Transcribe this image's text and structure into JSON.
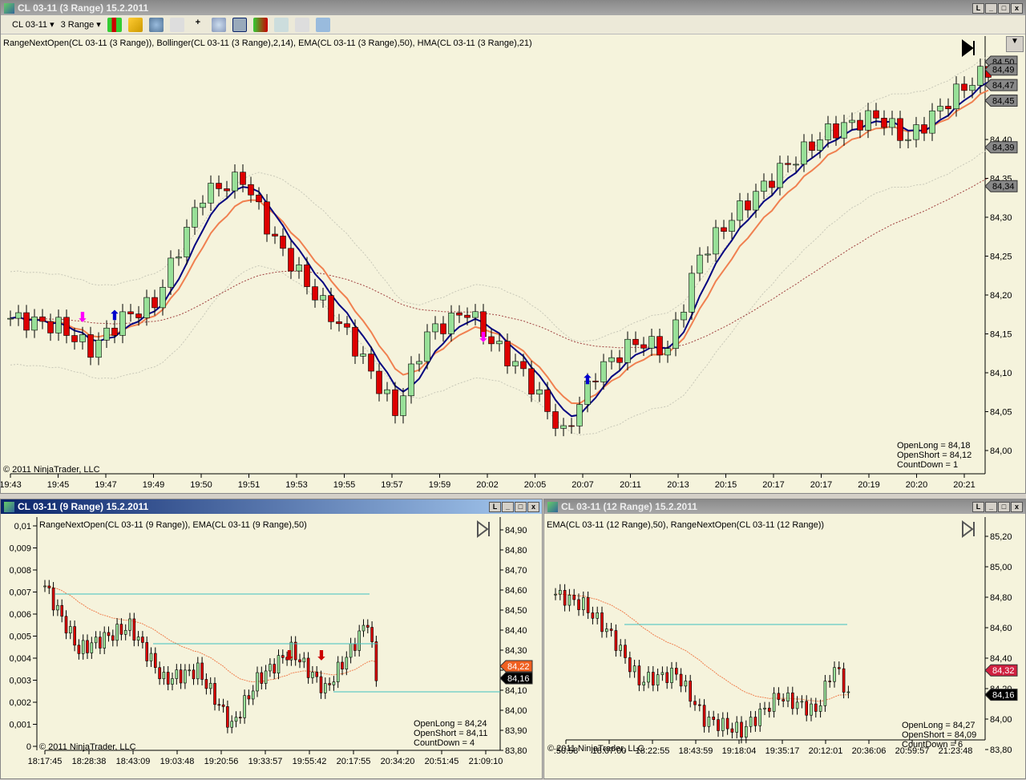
{
  "main": {
    "title": "CL 03-11 (3 Range)  15.2.2011",
    "instrument": "CL 03-11",
    "period": "3 Range",
    "indicators": "RangeNextOpen(CL 03-11 (3 Range)), Bollinger(CL 03-11 (3 Range),2,14), EMA(CL 03-11 (3 Range),50), HMA(CL 03-11 (3 Range),21)",
    "copyright": "© 2011 NinjaTrader, LLC",
    "open_long": "OpenLong = 84,18",
    "open_short": "OpenShort = 84,12",
    "countdown": "CountDown = 1",
    "price_ticks": [
      "84,00",
      "84,05",
      "84,10",
      "84,15",
      "84,20",
      "84,25",
      "84,30",
      "84,35",
      "84,40",
      "84,45",
      "84,50"
    ],
    "price_tags": [
      "84,50",
      "84,49",
      "84,47",
      "84,45",
      "84,39",
      "84,34"
    ],
    "time_ticks": [
      "19:43",
      "19:45",
      "19:47",
      "19:49",
      "19:50",
      "19:51",
      "19:53",
      "19:55",
      "19:57",
      "19:59",
      "20:02",
      "20:05",
      "20:07",
      "20:11",
      "20:13",
      "20:15",
      "20:17",
      "20:17",
      "20:19",
      "20:20",
      "20:21"
    ]
  },
  "left": {
    "title": "CL 03-11 (9 Range)  15.2.2011",
    "indicators": "RangeNextOpen(CL 03-11 (9 Range)), EMA(CL 03-11 (9 Range),50)",
    "copyright": "© 2011 NinjaTrader, LLC",
    "open_long": "OpenLong = 84,24",
    "open_short": "OpenShort = 84,11",
    "countdown": "CountDown = 4",
    "left_ticks": [
      "0",
      "0,001",
      "0,002",
      "0,003",
      "0,004",
      "0,005",
      "0,006",
      "0,007",
      "0,008",
      "0,009",
      "0,01"
    ],
    "price_ticks": [
      "83,80",
      "83,90",
      "84,00",
      "84,10",
      "84,20",
      "84,30",
      "84,40",
      "84,50",
      "84,60",
      "84,70",
      "84,80",
      "84,90"
    ],
    "tag_ema": "84,22",
    "tag_last": "84,16",
    "time_ticks": [
      "18:17:45",
      "18:28:38",
      "18:43:09",
      "19:03:48",
      "19:20:56",
      "19:33:57",
      "19:55:42",
      "20:17:55",
      "20:34:20",
      "20:51:45",
      "21:09:10"
    ]
  },
  "right": {
    "title": "CL 03-11 (12 Range)  15.2.2011",
    "indicators": "EMA(CL 03-11 (12 Range),50), RangeNextOpen(CL 03-11 (12 Range))",
    "copyright": "© 2011 NinjaTrader, LLC",
    "open_long": "OpenLong = 84,27",
    "open_short": "OpenShort = 84,09",
    "countdown": "CountDown = 6",
    "price_ticks": [
      "83,80",
      "84,00",
      "84,20",
      "84,40",
      "84,60",
      "84,80",
      "85,00",
      "85,20"
    ],
    "tag_ema": "84,32",
    "tag_last": "84,16",
    "time_ticks": [
      ":50:58",
      "18:07:00",
      "18:22:55",
      "18:43:59",
      "19:18:04",
      "19:35:17",
      "20:12:01",
      "20:36:06",
      "20:59:57",
      "21:23:48"
    ]
  },
  "colors": {
    "bg": "#f5f3dc",
    "up": "#98e098",
    "down": "#dd0000",
    "hma": "#000080",
    "ema": "#f08050",
    "boll": "#c8c8b8",
    "line": "#40c0c0"
  },
  "chart_data": [
    {
      "type": "candlestick",
      "name": "main",
      "path": [
        [
          0,
          84.17
        ],
        [
          6,
          84.16
        ],
        [
          10,
          84.13
        ],
        [
          14,
          84.17
        ],
        [
          18,
          84.19
        ],
        [
          24,
          84.33
        ],
        [
          29,
          84.35
        ],
        [
          33,
          84.27
        ],
        [
          38,
          84.2
        ],
        [
          42,
          84.15
        ],
        [
          48,
          84.05
        ],
        [
          52,
          84.15
        ],
        [
          57,
          84.18
        ],
        [
          60,
          84.14
        ],
        [
          64,
          84.1
        ],
        [
          69,
          84.02
        ],
        [
          73,
          84.1
        ],
        [
          78,
          84.14
        ],
        [
          82,
          84.13
        ],
        [
          86,
          84.25
        ],
        [
          90,
          84.3
        ],
        [
          96,
          84.36
        ],
        [
          102,
          84.41
        ],
        [
          108,
          84.43
        ],
        [
          112,
          84.4
        ],
        [
          118,
          84.46
        ],
        [
          122,
          84.49
        ]
      ],
      "ylim": [
        84.0,
        84.5
      ]
    },
    {
      "type": "candlestick",
      "name": "9range",
      "path": [
        [
          0,
          84.62
        ],
        [
          8,
          84.3
        ],
        [
          20,
          84.42
        ],
        [
          28,
          84.15
        ],
        [
          36,
          84.2
        ],
        [
          44,
          83.92
        ],
        [
          50,
          84.15
        ],
        [
          58,
          84.3
        ],
        [
          66,
          84.1
        ],
        [
          72,
          84.3
        ],
        [
          76,
          84.45
        ],
        [
          78,
          84.16
        ]
      ],
      "ylim": [
        83.8,
        84.9
      ]
    },
    {
      "type": "candlestick",
      "name": "12range",
      "path": [
        [
          0,
          84.82
        ],
        [
          6,
          84.75
        ],
        [
          12,
          84.55
        ],
        [
          18,
          84.25
        ],
        [
          26,
          84.3
        ],
        [
          32,
          84.0
        ],
        [
          40,
          83.92
        ],
        [
          48,
          84.15
        ],
        [
          56,
          84.05
        ],
        [
          60,
          84.35
        ],
        [
          63,
          84.16
        ]
      ],
      "ylim": [
        83.8,
        85.2
      ]
    }
  ]
}
